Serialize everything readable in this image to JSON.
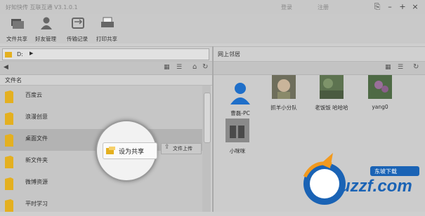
{
  "window": {
    "title": "好知快传 互联互通 V3.1.0.1",
    "login": "登录",
    "register": "注册",
    "controls": [
      "⎘",
      "–",
      "+",
      "×"
    ]
  },
  "toolbar": [
    {
      "label": "文件共享",
      "icon": "file-share-icon"
    },
    {
      "label": "好友管理",
      "icon": "user-icon"
    },
    {
      "label": "传输记录",
      "icon": "transfer-icon"
    },
    {
      "label": "打印共享",
      "icon": "printer-icon"
    }
  ],
  "path": {
    "value": "D:"
  },
  "network_panel": {
    "label": "网上邻居"
  },
  "file_list": {
    "column_header": "文件名",
    "items": [
      {
        "name": "百度云"
      },
      {
        "name": "浪漫创意"
      },
      {
        "name": "桌面文件"
      },
      {
        "name": "新文件夹"
      },
      {
        "name": "微博资源"
      },
      {
        "name": "平时学习"
      }
    ]
  },
  "context": {
    "share_label": "设为共享",
    "upload_label": "文件上传"
  },
  "network_users": [
    {
      "name": "曹磊-PC"
    },
    {
      "name": "抓羊小分队"
    },
    {
      "name": "老饭饭 哈哈哈"
    },
    {
      "name": "yang0"
    },
    {
      "name": "小咪咪"
    }
  ],
  "watermark": {
    "text": "uzzf.com",
    "tagline": "东坡下载"
  },
  "colors": {
    "folder": "#e4b020",
    "accent_blue": "#1f6fc9",
    "watermark_blue": "#1a63b5",
    "watermark_orange": "#f39a1e"
  }
}
